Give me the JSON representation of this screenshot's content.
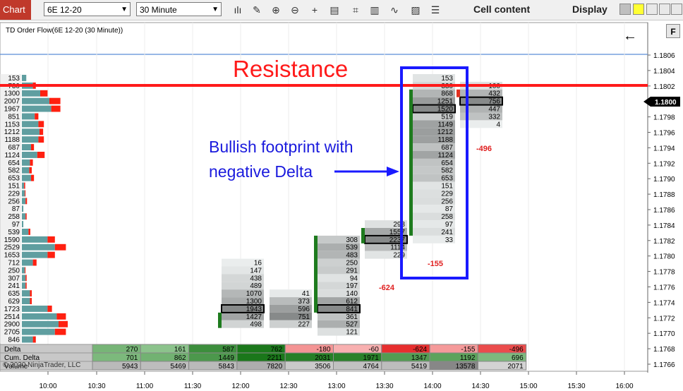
{
  "toolbar": {
    "chart_tab": "Chart",
    "instrument": "6E 12-20",
    "interval": "30 Minute",
    "cell_content_label": "Cell content",
    "display_label": "Display",
    "icons": [
      "bar-type-icon",
      "draw-pencil-icon",
      "zoom-in-icon",
      "zoom-out-icon",
      "crosshair-icon",
      "data-box-icon",
      "indicators-icon",
      "strategies-icon",
      "properties-icon",
      "menu-icon"
    ]
  },
  "chart": {
    "title": "TD Order Flow(6E 12-20 (30 Minute))",
    "copyright": "© 2020 NinjaTrader, LLC",
    "current_price": "1.1800",
    "price_axis": [
      "1.1806",
      "1.1804",
      "1.1802",
      "1.1800",
      "1.1798",
      "1.1796",
      "1.1794",
      "1.1792",
      "1.1790",
      "1.1788",
      "1.1786",
      "1.1784",
      "1.1782",
      "1.1780",
      "1.1778",
      "1.1776",
      "1.1774",
      "1.1772",
      "1.1770",
      "1.1768",
      "1.1766"
    ],
    "time_axis": [
      "10:00",
      "10:30",
      "11:00",
      "11:30",
      "12:00",
      "12:30",
      "13:00",
      "13:30",
      "14:00",
      "14:30",
      "15:00",
      "15:30",
      "16:00"
    ]
  },
  "annotations": {
    "resistance": "Resistance",
    "bullish_line1": "Bullish footprint with",
    "bullish_line2": "negative Delta"
  },
  "volume_profile": [
    {
      "v": "153",
      "g": 0.12,
      "r": 0
    },
    {
      "v": "730",
      "g": 0.3,
      "r": 0.08
    },
    {
      "v": "1300",
      "g": 0.5,
      "r": 0.2
    },
    {
      "v": "2007",
      "g": 0.75,
      "r": 0.3
    },
    {
      "v": "1967",
      "g": 0.8,
      "r": 0.25
    },
    {
      "v": "851",
      "g": 0.35,
      "r": 0.1
    },
    {
      "v": "1153",
      "g": 0.45,
      "r": 0.15
    },
    {
      "v": "1212",
      "g": 0.48,
      "r": 0.1
    },
    {
      "v": "1188",
      "g": 0.45,
      "r": 0.15
    },
    {
      "v": "687",
      "g": 0.25,
      "r": 0.08
    },
    {
      "v": "1124",
      "g": 0.42,
      "r": 0.2
    },
    {
      "v": "654",
      "g": 0.22,
      "r": 0.08
    },
    {
      "v": "582",
      "g": 0.2,
      "r": 0.07
    },
    {
      "v": "653",
      "g": 0.25,
      "r": 0.08
    },
    {
      "v": "151",
      "g": 0.06,
      "r": 0.03
    },
    {
      "v": "229",
      "g": 0.08,
      "r": 0.02
    },
    {
      "v": "256",
      "g": 0.1,
      "r": 0.04
    },
    {
      "v": "87",
      "g": 0.04,
      "r": 0
    },
    {
      "v": "258",
      "g": 0.1,
      "r": 0.03
    },
    {
      "v": "97",
      "g": 0.04,
      "r": 0
    },
    {
      "v": "539",
      "g": 0.18,
      "r": 0.05
    },
    {
      "v": "1590",
      "g": 0.7,
      "r": 0.2
    },
    {
      "v": "2529",
      "g": 0.9,
      "r": 0.3
    },
    {
      "v": "1653",
      "g": 0.7,
      "r": 0.2
    },
    {
      "v": "712",
      "g": 0.3,
      "r": 0.1
    },
    {
      "v": "250",
      "g": 0.08,
      "r": 0.02
    },
    {
      "v": "307",
      "g": 0.1,
      "r": 0.03
    },
    {
      "v": "241",
      "g": 0.1,
      "r": 0.03
    },
    {
      "v": "635",
      "g": 0.22,
      "r": 0.05
    },
    {
      "v": "629",
      "g": 0.22,
      "r": 0.05
    },
    {
      "v": "1723",
      "g": 0.7,
      "r": 0.12
    },
    {
      "v": "2514",
      "g": 0.95,
      "r": 0.25
    },
    {
      "v": "2900",
      "g": 1.0,
      "r": 0.25
    },
    {
      "v": "2705",
      "g": 0.9,
      "r": 0.3
    },
    {
      "v": "846",
      "g": 0.3,
      "r": 0.08
    }
  ],
  "footprints": [
    {
      "time": "12:00",
      "top_row": 24,
      "values": [
        "16",
        "147",
        "438",
        "489",
        "1070",
        "1300",
        "1943",
        "1427",
        "498"
      ],
      "boxed": 6,
      "bar": [
        7,
        9
      ],
      "bar_color": "#1e7b1e"
    },
    {
      "time": "12:30",
      "top_row": 28,
      "values": [
        "41",
        "373",
        "596",
        "751",
        "227"
      ],
      "boxed": -1,
      "bar": [
        0,
        0
      ],
      "bar_color": "#1e7b1e"
    },
    {
      "time": "13:00",
      "top_row": 21,
      "values": [
        "308",
        "539",
        "483",
        "250",
        "291",
        "94",
        "197",
        "140",
        "612",
        "841",
        "361",
        "527",
        "121"
      ],
      "boxed": 9,
      "bar": [
        0,
        10
      ],
      "bar_color": "#1e7b1e"
    },
    {
      "time": "13:30",
      "top_row": 19,
      "values": [
        "298",
        "1557",
        "2237",
        "1114",
        "229"
      ],
      "boxed": 2,
      "bar": [
        1,
        3
      ],
      "bar_color": "#1e7b1e"
    },
    {
      "time": "14:00",
      "top_row": 0,
      "values": [
        "153",
        "330",
        "868",
        "1251",
        "1520",
        "519",
        "1149",
        "1212",
        "1188",
        "687",
        "1124",
        "654",
        "582",
        "653",
        "151",
        "229",
        "256",
        "87",
        "258",
        "97",
        "241",
        "33"
      ],
      "boxed": 4,
      "bar": [
        2,
        21
      ],
      "bar_color": "#1e7b1e"
    },
    {
      "time": "14:30",
      "top_row": 1,
      "values": [
        "100",
        "432",
        "756",
        "447",
        "332",
        "4"
      ],
      "boxed": 2,
      "bar": [
        1,
        2
      ],
      "bar_color": "#e03020"
    }
  ],
  "candle_deltas": [
    "-624",
    "-155",
    "-496"
  ],
  "table": {
    "labels": [
      "Delta",
      "Cum. Delta",
      "Volume"
    ],
    "delta": [
      "270",
      "161",
      "587",
      "762",
      "-180",
      "-60",
      "-624",
      "-155",
      "-496"
    ],
    "cum_delta": [
      "701",
      "862",
      "1449",
      "2211",
      "2031",
      "1971",
      "1347",
      "1192",
      "696"
    ],
    "volume": [
      "5943",
      "5469",
      "5843",
      "7820",
      "3506",
      "4764",
      "5419",
      "13578",
      "2071"
    ]
  },
  "colors": {
    "resistance_line": "#ff1a1a",
    "annotation_box": "#1a1aff",
    "blue_text": "#1a1add",
    "red_text": "#ff1a1a",
    "green": "#1e7b1e",
    "profile_bar": "#5f9ea0",
    "profile_sell": "#ff2010"
  }
}
